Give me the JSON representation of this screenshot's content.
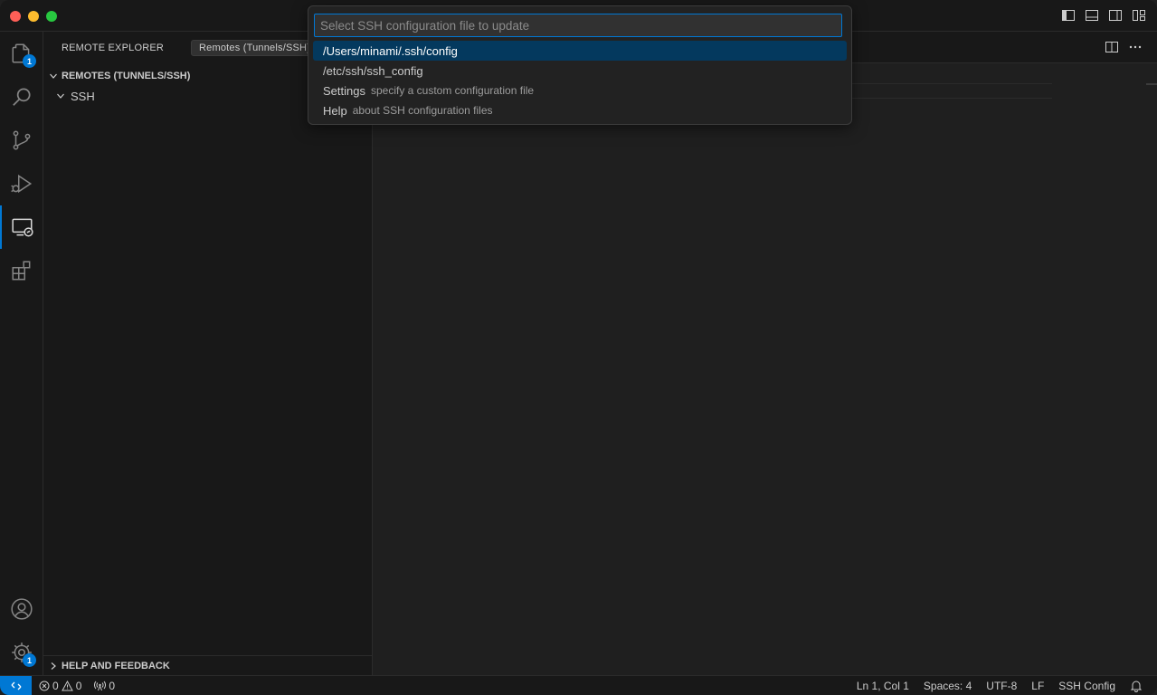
{
  "sidebar": {
    "header_title": "REMOTE EXPLORER",
    "remote_select": "Remotes (Tunnels/SSH)",
    "section_title": "REMOTES (TUNNELS/SSH)",
    "tree_item": "SSH",
    "help_section": "HELP AND FEEDBACK"
  },
  "activity_bar": {
    "items": [
      {
        "icon": "files-icon",
        "badge": "1"
      },
      {
        "icon": "search-icon"
      },
      {
        "icon": "source-control-icon"
      },
      {
        "icon": "run-debug-icon"
      },
      {
        "icon": "remote-explorer-icon"
      },
      {
        "icon": "extensions-icon"
      }
    ],
    "accounts_icon": "account-icon",
    "settings_badge": "1"
  },
  "quick_pick": {
    "placeholder": "Select SSH configuration file to update",
    "items": [
      {
        "label": "/Users/minami/.ssh/config",
        "description": ""
      },
      {
        "label": "/etc/ssh/ssh_config",
        "description": ""
      },
      {
        "label": "Settings",
        "description": "specify a custom configuration file"
      },
      {
        "label": "Help",
        "description": "about SSH configuration files"
      }
    ]
  },
  "statusbar": {
    "errors": "0",
    "warnings": "0",
    "ports": "0",
    "position": "Ln 1, Col 1",
    "spaces": "Spaces: 4",
    "encoding": "UTF-8",
    "eol": "LF",
    "language": "SSH Config"
  },
  "colors": {
    "accent": "#0078d4",
    "selection": "#04395e",
    "background": "#1f1f1f",
    "sidebar": "#181818"
  }
}
